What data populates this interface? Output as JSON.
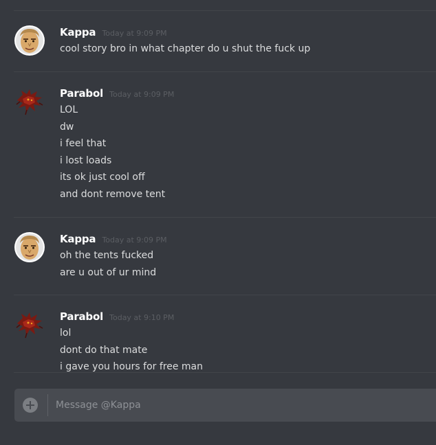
{
  "messages": [
    {
      "username": "Kappa",
      "avatar_icon": "kappa-face-avatar",
      "timestamp": "Today at 9:09 PM",
      "lines": [
        "cool story bro in what chapter do u shut the fuck up"
      ]
    },
    {
      "username": "Parabol",
      "avatar_icon": "red-dragon-avatar",
      "timestamp": "Today at 9:09 PM",
      "lines": [
        "LOL",
        "dw",
        "i feel that",
        "i lost loads",
        "its ok just cool off",
        "and dont remove tent"
      ]
    },
    {
      "username": "Kappa",
      "avatar_icon": "kappa-face-avatar",
      "timestamp": "Today at 9:09 PM",
      "lines": [
        "oh the tents fucked",
        "are u out of ur mind"
      ]
    },
    {
      "username": "Parabol",
      "avatar_icon": "red-dragon-avatar",
      "timestamp": "Today at 9:10 PM",
      "lines": [
        "lol",
        "dont do that mate",
        "i gave you hours for free man"
      ]
    }
  ],
  "composer": {
    "placeholder": "Message @Kappa",
    "value": "",
    "add_icon": "plus-circle-icon"
  },
  "colors": {
    "background": "#36393f",
    "composer": "#484b51",
    "username": "#ffffff",
    "message_text": "#dcddde",
    "timestamp": "#5b5e63"
  }
}
